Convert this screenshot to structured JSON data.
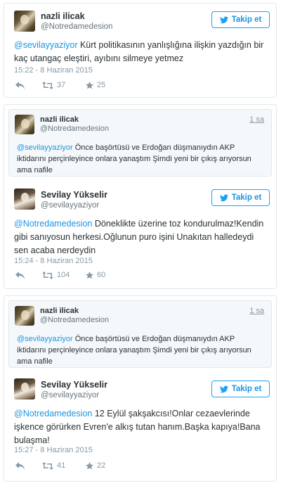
{
  "follow_label": "Takip et",
  "tweet1": {
    "name": "nazli ilicak",
    "handle": "@Notredamedesion",
    "mention": "@sevilayyaziyor",
    "text": " Kürt politikasının yanlışlığına ilişkin yazdığın bir kaç utangaç eleştiri, ayıbını silmeye yetmez",
    "timestamp": "15:22 - 8 Haziran 2015",
    "retweets": "37",
    "likes": "25"
  },
  "quote": {
    "name": "nazli ilicak",
    "handle": "@Notredamedesion",
    "time": "1 sa",
    "mention": "@sevilayyaziyor",
    "text": " Önce başörtüsü ve Erdoğan düşmanıydın AKP iktidarını perçinleyince onlara yanaştım Şimdi yeni bir çıkış arıyorsun ama nafile"
  },
  "tweet2": {
    "name": "Sevilay Yükselir",
    "handle": "@sevilayyaziyor",
    "mention": "@Notredamedesion",
    "text": " Döneklikte üzerine toz kondurulmaz!Kendin gibi sanıyosun herkesi.Oğlunun puro işini Unakıtan halledeydi sen acaba nerdeydin",
    "timestamp": "15:24 - 8 Haziran 2015",
    "retweets": "104",
    "likes": "60"
  },
  "tweet3": {
    "name": "Sevilay Yükselir",
    "handle": "@sevilayyaziyor",
    "mention": "@Notredamedesion",
    "text": " 12 Eylül şakşakcısı!Onlar cezaevlerinde işkence görürken Evren'e alkış tutan hanım.Başka kapıya!Bana bulaşma!",
    "timestamp": "15:27 - 8 Haziran 2015",
    "retweets": "41",
    "likes": "22"
  },
  "colors": {
    "accent": "#1da1f2",
    "link": "#1b95e0",
    "muted": "#8899a6",
    "border": "#e1e8ed",
    "quote_bg": "#f5f8fa"
  },
  "icons": [
    "twitter-bird-icon",
    "reply-icon",
    "retweet-icon",
    "star-icon"
  ]
}
